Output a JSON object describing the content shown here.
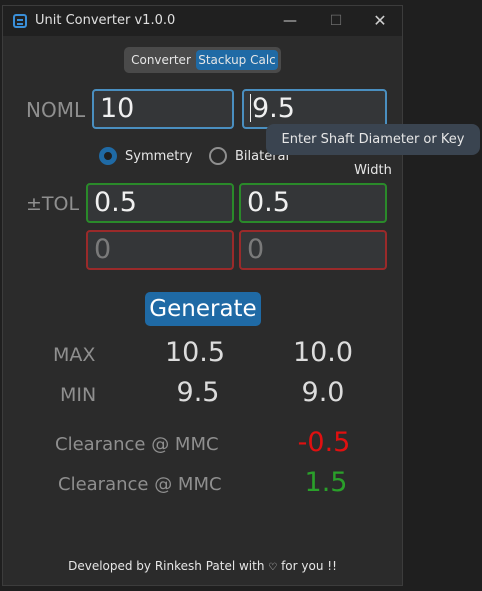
{
  "window": {
    "title": "Unit Converter v1.0.0",
    "min_glyph": "—",
    "max_glyph": "☐",
    "close_glyph": "✕"
  },
  "tabs": [
    {
      "label": "Converter",
      "active": false
    },
    {
      "label": "Stackup Calc",
      "active": true
    }
  ],
  "noml": {
    "label": "NOML",
    "field1": "10",
    "field2": "9.5",
    "tooltip": "Enter Shaft Diameter or Key Width"
  },
  "mode": {
    "symmetry_label": "Symmetry",
    "bilateral_label": "Bilateral",
    "selected": "Symmetry"
  },
  "tol": {
    "label": "±TOL",
    "plus1": "0.5",
    "plus2": "0.5",
    "minus1": "0",
    "minus2": "0"
  },
  "generate_label": "Generate",
  "results": {
    "max_label": "MAX",
    "min_label": "MIN",
    "max1": "10.5",
    "max2": "10.0",
    "min1": "9.5",
    "min2": "9.0",
    "clearance_label_1": "Clearance @ MMC",
    "clearance_value_1": "-0.5",
    "clearance_label_2": "Clearance @ MMC",
    "clearance_value_2": "1.5"
  },
  "footer": {
    "before": "Developed by Rinkesh Patel with",
    "after": "for you !!"
  },
  "colors": {
    "accent": "#1f6aa5",
    "negative": "#e01010",
    "positive": "#2aa02a"
  }
}
